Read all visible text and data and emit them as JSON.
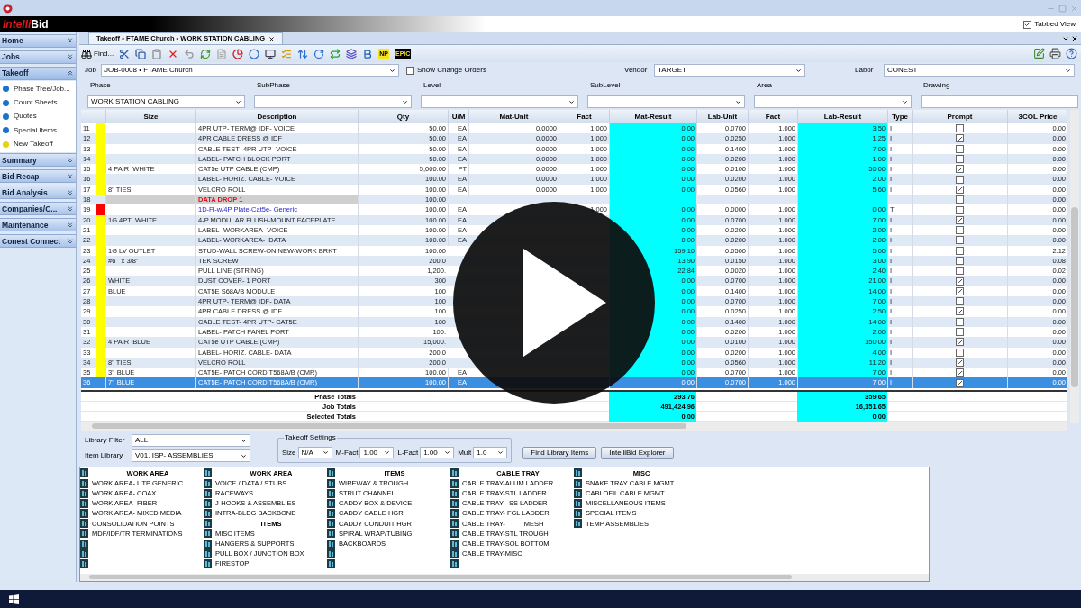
{
  "window": {
    "logo": {
      "prefix": "Intelli",
      "suffix": "Bid"
    },
    "tabbed_view": {
      "label": "Tabbed View",
      "checked": true
    }
  },
  "sidebar": [
    {
      "label": "Home",
      "expanded": false
    },
    {
      "label": "Jobs",
      "expanded": false
    },
    {
      "label": "Takeoff",
      "expanded": true,
      "children": [
        {
          "label": "Phase Tree/Job...",
          "color": "#1a73c9"
        },
        {
          "label": "Count Sheets",
          "color": "#1a73c9"
        },
        {
          "label": "Quotes",
          "color": "#1a73c9"
        },
        {
          "label": "Special Items",
          "color": "#1a73c9"
        },
        {
          "label": "New Takeoff",
          "color": "#e8d20c"
        }
      ]
    },
    {
      "label": "Summary",
      "expanded": false
    },
    {
      "label": "Bid Recap",
      "expanded": false
    },
    {
      "label": "Bid Analysis",
      "expanded": false
    },
    {
      "label": "Companies/C...",
      "expanded": false
    },
    {
      "label": "Maintenance",
      "expanded": false
    },
    {
      "label": "Conest Connect",
      "expanded": false
    }
  ],
  "tab": {
    "label": "Takeoff • FTAME Church • WORK STATION CABLING"
  },
  "toolbar": {
    "find": "Find...",
    "badges": [
      "NP",
      "EPIC"
    ]
  },
  "job": {
    "label": "Job",
    "value": "JOB-0008 • FTAME Church"
  },
  "show_change_orders": {
    "label": "Show Change Orders",
    "checked": false
  },
  "vendor": {
    "label": "Vendor",
    "value": "TARGET"
  },
  "labor": {
    "label": "Labor",
    "value": "CONEST"
  },
  "filters": [
    {
      "label": "Phase",
      "value": "WORK STATION CABLING",
      "kind": "dropdown"
    },
    {
      "label": "SubPhase",
      "kind": "dropdown"
    },
    {
      "label": "Level",
      "kind": "dropdown"
    },
    {
      "label": "SubLevel",
      "kind": "dropdown"
    },
    {
      "label": "Area",
      "kind": "dropdown"
    },
    {
      "label": "Drawing",
      "kind": "text"
    }
  ],
  "table": {
    "columns": [
      "Size",
      "Description",
      "Qty",
      "U/M",
      "Mat-Unit",
      "Fact",
      "Mat-Result",
      "Lab-Unit",
      "Fact",
      "Lab-Result",
      "Type",
      "Prompt",
      "3COL Price"
    ],
    "rows": [
      {
        "num": "11",
        "color": "#ffff00",
        "kind": "item",
        "selected": false,
        "cells": [
          null,
          "4PR UTP- TERM@ IDF- VOICE",
          "50.00",
          "EA",
          "0.0000",
          "1.000",
          "0.00",
          "0.0700",
          "1.000",
          "3.50",
          "I"
        ],
        "checked": false,
        "price": "0.00"
      },
      {
        "num": "12",
        "color": "#ffff00",
        "kind": "item",
        "selected": false,
        "cells": [
          null,
          "4PR CABLE DRESS @ IDF",
          "50.00",
          "EA",
          "0.0000",
          "1.000",
          "0.00",
          "0.0250",
          "1.000",
          "1.25",
          "I"
        ],
        "checked": true,
        "price": "0.00"
      },
      {
        "num": "13",
        "color": "#ffff00",
        "kind": "item",
        "selected": false,
        "cells": [
          null,
          "CABLE TEST- 4PR UTP- VOICE",
          "50.00",
          "EA",
          "0.0000",
          "1.000",
          "0.00",
          "0.1400",
          "1.000",
          "7.00",
          "I"
        ],
        "checked": false,
        "price": "0.00"
      },
      {
        "num": "14",
        "color": "#ffff00",
        "kind": "item",
        "selected": false,
        "cells": [
          null,
          "LABEL- PATCH BLOCK PORT",
          "50.00",
          "EA",
          "0.0000",
          "1.000",
          "0.00",
          "0.0200",
          "1.000",
          "1.00",
          "I"
        ],
        "checked": false,
        "price": "0.00"
      },
      {
        "num": "15",
        "color": "#ffff00",
        "kind": "item",
        "selected": false,
        "cells": [
          "4 PAIR  WHITE",
          "CAT5e UTP CABLE (CMP)",
          "5,000.00",
          "FT",
          "0.0000",
          "1.000",
          "0.00",
          "0.0100",
          "1.000",
          "50.00",
          "I"
        ],
        "checked": true,
        "price": "0.00"
      },
      {
        "num": "16",
        "color": "#ffff00",
        "kind": "item",
        "selected": false,
        "cells": [
          null,
          "LABEL- HORIZ. CABLE- VOICE",
          "100.00",
          "EA",
          "0.0000",
          "1.000",
          "0.00",
          "0.0200",
          "1.000",
          "2.00",
          "I"
        ],
        "checked": false,
        "price": "0.00"
      },
      {
        "num": "17",
        "color": "#ffff00",
        "kind": "item",
        "selected": false,
        "cells": [
          "8\" TIES",
          "VELCRO ROLL",
          "100.00",
          "EA",
          "0.0000",
          "1.000",
          "0.00",
          "0.0560",
          "1.000",
          "5.60",
          "I"
        ],
        "checked": true,
        "price": "0.00"
      },
      {
        "num": "18",
        "kind": "group",
        "selected": false,
        "cells": [
          null,
          "DATA DROP 1",
          "100.00",
          null,
          null,
          null,
          null,
          null,
          null,
          null,
          null
        ],
        "checked": false,
        "price": "0.00"
      },
      {
        "num": "19",
        "color": "#ff0000",
        "kind": "assembly",
        "selected": false,
        "cells": [
          null,
          "1D-Fl-w/4P Plate-Cat5e- Generic",
          "100.00",
          "EA",
          null,
          "1.000",
          "0.00",
          "0.0000",
          "1.000",
          "0.00",
          "T"
        ],
        "checked": false,
        "price": "0.00"
      },
      {
        "num": "20",
        "color": "#ffff00",
        "kind": "item",
        "selected": false,
        "cells": [
          "1G 4PT  WHITE",
          "4-P MODULAR FLUSH-MOUNT FACEPLATE",
          "100.00",
          "EA",
          null,
          null,
          "0.00",
          "0.0700",
          "1.000",
          "7.00",
          "I"
        ],
        "checked": true,
        "price": "0.00"
      },
      {
        "num": "21",
        "color": "#ffff00",
        "kind": "item",
        "selected": false,
        "cells": [
          null,
          "LABEL- WORKAREA- VOICE",
          "100.00",
          "EA",
          null,
          null,
          "0.00",
          "0.0200",
          "1.000",
          "2.00",
          "I"
        ],
        "checked": false,
        "price": "0.00"
      },
      {
        "num": "22",
        "color": "#ffff00",
        "kind": "item",
        "selected": false,
        "cells": [
          null,
          "LABEL- WORKAREA-  DATA",
          "100.00",
          "EA",
          null,
          null,
          "0.00",
          "0.0200",
          "1.000",
          "2.00",
          "I"
        ],
        "checked": false,
        "price": "0.00"
      },
      {
        "num": "23",
        "color": "#ffff00",
        "kind": "item",
        "selected": false,
        "cells": [
          "1G LV OUTLET",
          "STUD-WALL SCREW-ON NEW-WORK BRKT",
          "100.00",
          null,
          null,
          null,
          "159.10",
          "0.0500",
          "1.000",
          "5.00",
          "I"
        ],
        "checked": false,
        "price": "2.12"
      },
      {
        "num": "24",
        "color": "#ffff00",
        "kind": "item",
        "selected": false,
        "cells": [
          "#6   x 3/8\"",
          "TEK SCREW",
          "200.0",
          null,
          null,
          null,
          "13.90",
          "0.0150",
          "1.000",
          "3.00",
          "I"
        ],
        "checked": false,
        "price": "0.08"
      },
      {
        "num": "25",
        "color": "#ffff00",
        "kind": "item",
        "selected": false,
        "cells": [
          null,
          "PULL LINE (STRING)",
          "1,200.",
          null,
          null,
          null,
          "22.84",
          "0.0020",
          "1.000",
          "2.40",
          "I"
        ],
        "checked": false,
        "price": "0.02"
      },
      {
        "num": "26",
        "color": "#ffff00",
        "kind": "item",
        "selected": false,
        "cells": [
          "WHITE",
          "DUST COVER- 1 PORT",
          "300",
          null,
          null,
          null,
          "0.00",
          "0.0700",
          "1.000",
          "21.00",
          "I"
        ],
        "checked": true,
        "price": "0.00"
      },
      {
        "num": "27",
        "color": "#ffff00",
        "kind": "item",
        "selected": false,
        "cells": [
          "BLUE",
          "CAT5E S68A/B MODULE",
          "100",
          null,
          null,
          null,
          "0.00",
          "0.1400",
          "1.000",
          "14.00",
          "I"
        ],
        "checked": true,
        "price": "0.00"
      },
      {
        "num": "28",
        "color": "#ffff00",
        "kind": "item",
        "selected": false,
        "cells": [
          null,
          "4PR UTP- TERM@ IDF- DATA",
          "100",
          null,
          null,
          null,
          "0.00",
          "0.0700",
          "1.000",
          "7.00",
          "I"
        ],
        "checked": false,
        "price": "0.00"
      },
      {
        "num": "29",
        "color": "#ffff00",
        "kind": "item",
        "selected": false,
        "cells": [
          null,
          "4PR CABLE DRESS @ IDF",
          "100",
          null,
          null,
          null,
          "0.00",
          "0.0250",
          "1.000",
          "2.50",
          "I"
        ],
        "checked": true,
        "price": "0.00"
      },
      {
        "num": "30",
        "color": "#ffff00",
        "kind": "item",
        "selected": false,
        "cells": [
          null,
          "CABLE TEST- 4PR UTP- CAT5E",
          "100",
          null,
          null,
          null,
          "0.00",
          "0.1400",
          "1.000",
          "14.00",
          "I"
        ],
        "checked": false,
        "price": "0.00"
      },
      {
        "num": "31",
        "color": "#ffff00",
        "kind": "item",
        "selected": false,
        "cells": [
          null,
          "LABEL- PATCH PANEL PORT",
          "100.",
          null,
          null,
          null,
          "0.00",
          "0.0200",
          "1.000",
          "2.00",
          "I"
        ],
        "checked": false,
        "price": "0.00"
      },
      {
        "num": "32",
        "color": "#ffff00",
        "kind": "item",
        "selected": false,
        "cells": [
          "4 PAIR  BLUE",
          "CAT5e UTP CABLE (CMP)",
          "15,000.",
          null,
          null,
          null,
          "0.00",
          "0.0100",
          "1.000",
          "150.00",
          "I"
        ],
        "checked": true,
        "price": "0.00"
      },
      {
        "num": "33",
        "color": "#ffff00",
        "kind": "item",
        "selected": false,
        "cells": [
          null,
          "LABEL- HORIZ. CABLE- DATA",
          "200.0",
          null,
          null,
          null,
          "0.00",
          "0.0200",
          "1.000",
          "4.00",
          "I"
        ],
        "checked": false,
        "price": "0.00"
      },
      {
        "num": "34",
        "color": "#ffff00",
        "kind": "item",
        "selected": false,
        "cells": [
          "8\" TIES",
          "VELCRO ROLL",
          "200.0",
          null,
          null,
          null,
          "0.00",
          "0.0560",
          "1.000",
          "11.20",
          "I"
        ],
        "checked": true,
        "price": "0.00"
      },
      {
        "num": "35",
        "color": "#ffff00",
        "kind": "item",
        "selected": false,
        "cells": [
          "3'  BLUE",
          "CAT5E- PATCH CORD T568A/B (CMR)",
          "100.00",
          "EA",
          null,
          null,
          "0.00",
          "0.0700",
          "1.000",
          "7.00",
          "I"
        ],
        "checked": true,
        "price": "0.00"
      },
      {
        "num": "36",
        "kind": "item",
        "selected": true,
        "cells": [
          "7'  BLUE",
          "CAT5E- PATCH CORD T568A/B (CMR)",
          "100.00",
          "EA",
          null,
          null,
          "0.00",
          "0.0700",
          "1.000",
          "7.00",
          "I"
        ],
        "checked": true,
        "price": "0.00"
      }
    ],
    "totals": [
      {
        "label": "Phase Totals",
        "mat_result": "293.76",
        "lab_result": "359.65"
      },
      {
        "label": "Job Totals",
        "mat_result": "491,424.96",
        "lab_result": "16,151.65"
      },
      {
        "label": "Selected Totals",
        "mat_result": "0.00",
        "lab_result": "0.00"
      }
    ]
  },
  "library": {
    "filter": {
      "label": "Library Filter",
      "value": "ALL"
    },
    "item_library": {
      "label": "Item Library",
      "value": "V01. ISP- ASSEMBLIES"
    },
    "takeoff_settings": {
      "title": "Takeoff Settings",
      "fields": [
        {
          "label": "Size",
          "value": "N/A"
        },
        {
          "label": "M-Fact",
          "value": "1.00"
        },
        {
          "label": "L-Fact",
          "value": "1.00"
        },
        {
          "label": "Mult",
          "value": "1.0"
        }
      ]
    },
    "buttons": [
      "Find Library Items",
      "IntelliBid Explorer"
    ],
    "columns": [
      [
        {
          "kind": "heading",
          "label": "WORK AREA"
        },
        {
          "kind": "item",
          "label": "WORK AREA- UTP GENERIC"
        },
        {
          "kind": "item",
          "label": "WORK AREA- COAX"
        },
        {
          "kind": "item",
          "label": "WORK AREA- FIBER"
        },
        {
          "kind": "item",
          "label": "WORK AREA- MIXED MEDIA"
        },
        {
          "kind": "item",
          "label": "CONSOLIDATION POINTS"
        },
        {
          "kind": "item",
          "label": "MDF/IDF/TR TERMINATIONS"
        },
        {
          "kind": "empty"
        },
        {
          "kind": "empty"
        },
        {
          "kind": "empty"
        }
      ],
      [
        {
          "kind": "heading",
          "label": "WORK AREA"
        },
        {
          "kind": "item",
          "label": "VOICE / DATA / STUBS"
        },
        {
          "kind": "item",
          "label": "RACEWAYS"
        },
        {
          "kind": "item",
          "label": "J-HOOKS & ASSEMBLIES"
        },
        {
          "kind": "item",
          "label": "INTRA-BLDG BACKBONE"
        },
        {
          "kind": "heading",
          "label": "ITEMS"
        },
        {
          "kind": "item",
          "label": "MISC ITEMS"
        },
        {
          "kind": "item",
          "label": "HANGERS & SUPPORTS"
        },
        {
          "kind": "item",
          "label": "PULL BOX / JUNCTION BOX"
        },
        {
          "kind": "item",
          "label": "FIRESTOP"
        }
      ],
      [
        {
          "kind": "heading",
          "label": "ITEMS"
        },
        {
          "kind": "item",
          "label": "WIREWAY & TROUGH"
        },
        {
          "kind": "item",
          "label": "STRUT CHANNEL"
        },
        {
          "kind": "item",
          "label": "CADDY BOX & DEVICE"
        },
        {
          "kind": "item",
          "label": "CADDY CABLE HGR"
        },
        {
          "kind": "item",
          "label": "CADDY CONDUIT HGR"
        },
        {
          "kind": "item",
          "label": "SPIRAL WRAP/TUBING"
        },
        {
          "kind": "item",
          "label": "BACKBOARDS"
        },
        {
          "kind": "empty"
        },
        {
          "kind": "empty"
        }
      ],
      [
        {
          "kind": "heading",
          "label": "CABLE TRAY"
        },
        {
          "kind": "item",
          "label": "CABLE TRAY-ALUM LADDER"
        },
        {
          "kind": "item",
          "label": "CABLE TRAY-STL LADDER"
        },
        {
          "kind": "item",
          "label": "CABLE TRAY-  SS LADDER"
        },
        {
          "kind": "item",
          "label": "CABLE TRAY- FGL LADDER"
        },
        {
          "kind": "item",
          "label": "CABLE TRAY-          MESH"
        },
        {
          "kind": "item",
          "label": "CABLE TRAY-STL TROUGH"
        },
        {
          "kind": "item",
          "label": "CABLE TRAY-SOL BOTTOM"
        },
        {
          "kind": "item",
          "label": "CABLE TRAY-MISC"
        },
        {
          "kind": "empty"
        }
      ],
      [
        {
          "kind": "heading",
          "label": "MISC"
        },
        {
          "kind": "item",
          "label": "SNAKE TRAY CABLE MGMT"
        },
        {
          "kind": "item",
          "label": "CABLOFIL CABLE MGMT"
        },
        {
          "kind": "item",
          "label": "MISCELLANEOUS ITEMS"
        },
        {
          "kind": "item",
          "label": "SPECIAL ITEMS"
        },
        {
          "kind": "item",
          "label": "TEMP ASSEMBLIES"
        }
      ]
    ]
  }
}
